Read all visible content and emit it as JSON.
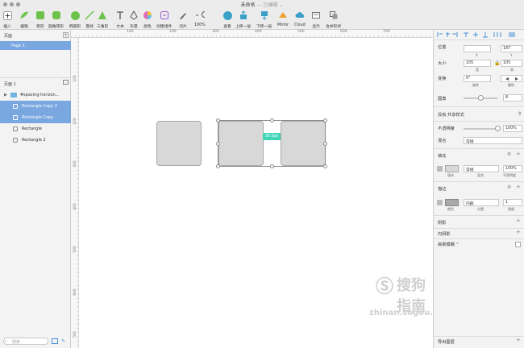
{
  "window": {
    "title": "未命名",
    "subtitle": "— 已编辑 ⌄"
  },
  "toolbar": {
    "insert": "插入",
    "edit": "编辑",
    "rect": "矩形",
    "rounded_rect": "圆角矩形",
    "oval": "椭圆形",
    "line": "直线",
    "triangle": "三角形",
    "text": "文本",
    "vector": "矢量",
    "color": "颜色",
    "create_symbol": "创建组件",
    "slice": "切片",
    "zoom_value": "100%",
    "view": "查看",
    "forward": "上移一层",
    "backward": "下移一层",
    "mirror": "Mirror",
    "cloud": "Cloud",
    "display": "显示",
    "combine": "合并形状"
  },
  "left_panel": {
    "pages_header": "页面",
    "page1": "Page 1",
    "layers_header": "页面 1",
    "layers": [
      "#spacing-horizon...",
      "Rectangle Copy 2",
      "Rectangle Copy",
      "Rectangle",
      "Rectangle 2"
    ],
    "search_placeholder": "搜索"
  },
  "ruler": {
    "top": [
      "100",
      "200",
      "300",
      "400",
      "500",
      "600",
      "700"
    ],
    "left": [
      "100",
      "200",
      "300",
      "400",
      "500",
      "600",
      "700"
    ]
  },
  "canvas": {
    "spacing_label": "39.5px"
  },
  "inspector": {
    "position_label": "位置",
    "x_value": "",
    "y_value": "187",
    "x_sub": "X",
    "y_sub": "Y",
    "size_label": "大小",
    "w_value": "105",
    "h_value": "105",
    "w_sub": "宽",
    "h_sub": "高",
    "transform_label": "变换",
    "rotate_value": "0°",
    "rotate_sub": "旋转",
    "flip_sub": "翻转",
    "radius_label": "圆角",
    "radius_value": "8",
    "shared_style": "没有 共享样式",
    "opacity_label": "不透明度",
    "opacity_value": "100%",
    "blend_label": "混合",
    "blend_value": "常规",
    "fill_label": "填充",
    "fill_blend": "常规",
    "fill_opacity": "100%",
    "fill_sub1": "填充",
    "fill_sub2": "混合",
    "fill_sub3": "不透明度",
    "border_label": "描边",
    "border_pos": "内部",
    "border_width": "1",
    "border_sub1": "颜色",
    "border_sub2": "位置",
    "border_sub3": "粗细",
    "shadow_label": "阴影",
    "inner_shadow_label": "内阴影",
    "blur_label": "高斯模糊 ⌃",
    "export_label": "导出图层"
  },
  "watermark": {
    "brand": "搜狗指南",
    "url": "zhinan.sogou.com"
  },
  "colors": {
    "accent": "#4b8fd8",
    "selection": "#7aa7e0",
    "green_tool": "#6cc24a",
    "spacing": "#3fd6b8"
  }
}
